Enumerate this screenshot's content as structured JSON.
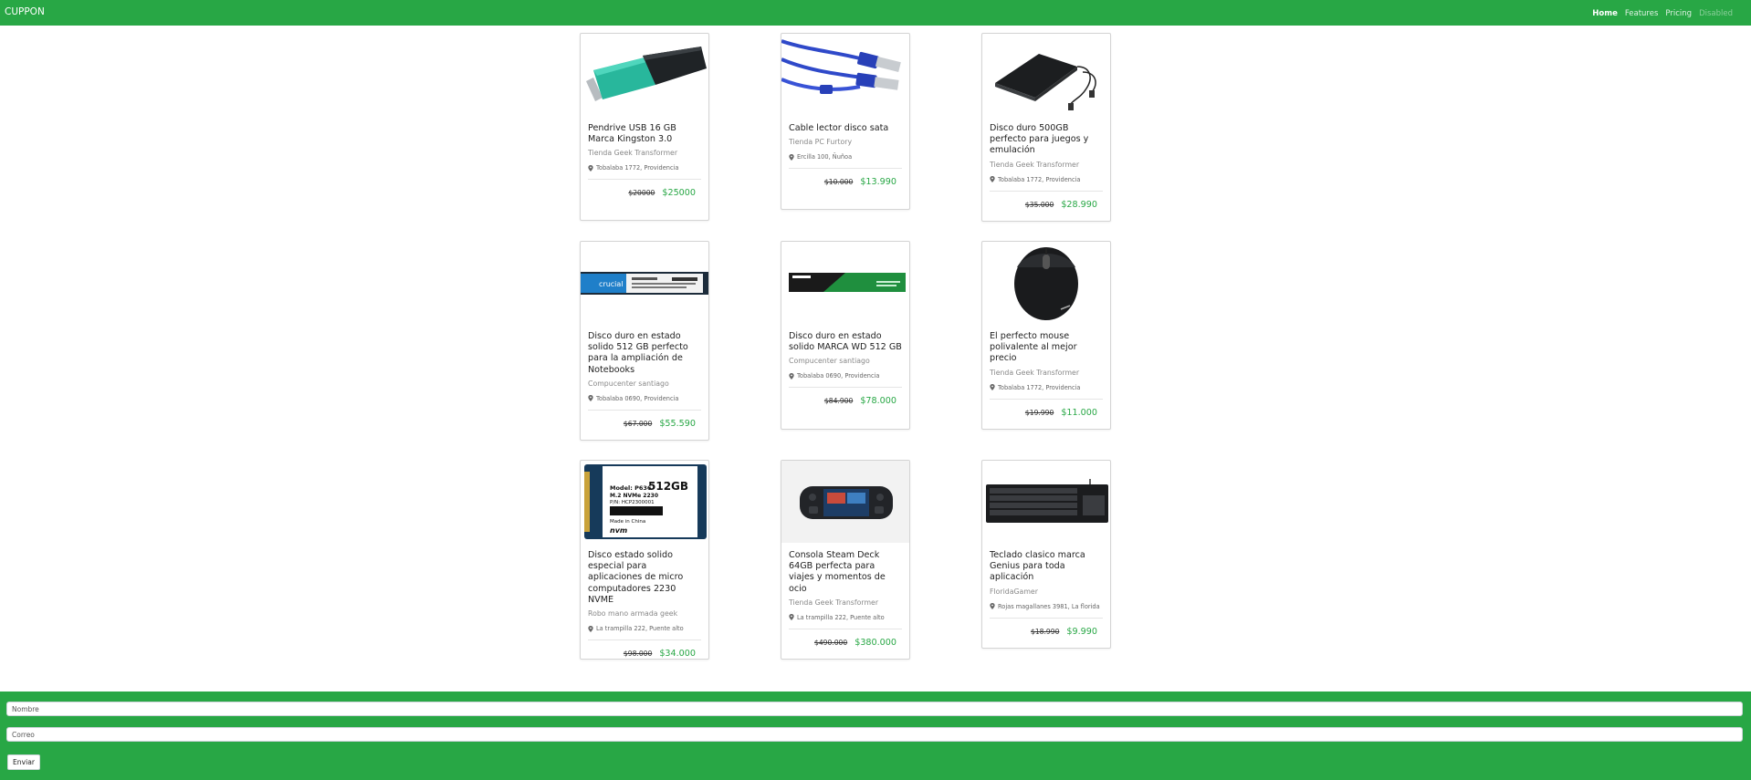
{
  "navbar": {
    "brand": "CUPPON",
    "links": [
      "Home",
      "Features",
      "Pricing",
      "Disabled"
    ]
  },
  "products": [
    {
      "title": "Pendrive USB 16 GB Marca Kingston 3.0",
      "store": "Tienda Geek Transformer",
      "location": "Tobalaba 1772, Providencia",
      "old_price": "$20000",
      "new_price": "$25000"
    },
    {
      "title": "Cable lector disco sata",
      "store": "Tienda PC Furtory",
      "location": "Ercilla 100, Ñuñoa",
      "old_price": "$10.000",
      "new_price": "$13.990"
    },
    {
      "title": "Disco duro 500GB perfecto para juegos y emulación",
      "store": "Tienda Geek Transformer",
      "location": "Tobalaba 1772, Providencia",
      "old_price": "$35.000",
      "new_price": "$28.990"
    },
    {
      "title": "Disco duro en estado solido 512 GB perfecto para la ampliación de Notebooks",
      "store": "Compucenter santiago",
      "location": "Tobalaba 0690, Providencia",
      "old_price": "$67.000",
      "new_price": "$55.590"
    },
    {
      "title": "Disco duro en estado solido MARCA WD 512 GB",
      "store": "Compucenter santiago",
      "location": "Tobalaba 0690, Providencia",
      "old_price": "$84.900",
      "new_price": "$78.000"
    },
    {
      "title": "El perfecto mouse polivalente al mejor precio",
      "store": "Tienda Geek Transformer",
      "location": "Tobalaba 1772, Providencia",
      "old_price": "$19.990",
      "new_price": "$11.000"
    },
    {
      "title": "Disco estado solido especial para aplicaciones de micro computadores 2230 NVME",
      "store": "Robo mano armada geek",
      "location": "La trampilla 222, Puente alto",
      "old_price": "$98.000",
      "new_price": "$34.000"
    },
    {
      "title": "Consola Steam Deck 64GB perfecta para viajes y momentos de ocio",
      "store": "Tienda Geek Transformer",
      "location": "La trampilla 222, Puente alto",
      "old_price": "$490.000",
      "new_price": "$380.000"
    },
    {
      "title": "Teclado clasico marca Genius para toda aplicación",
      "store": "FloridaGamer",
      "location": "Rojas magallanes 3981, La florida",
      "old_price": "$18.990",
      "new_price": "$9.990"
    }
  ],
  "ssd_label": {
    "brand": "crucial",
    "capacity": "512GB",
    "model": "Model: P636",
    "type": "M.2 NVMe 2230",
    "pn": "P/N: HCP2300001",
    "made": "Made in China",
    "logo": "nvm"
  },
  "footer": {
    "name_placeholder": "Nombre",
    "email_placeholder": "Correo",
    "submit_label": "Enviar"
  },
  "colors": {
    "accent": "#28a745"
  }
}
